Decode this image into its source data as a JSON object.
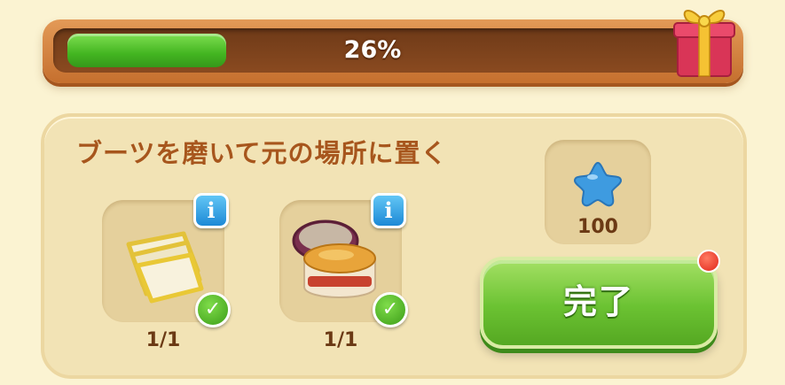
{
  "progress": {
    "percent_label": "26%",
    "fraction": 0.26
  },
  "task": {
    "title": "ブーツを磨いて元の場所に置く",
    "items": [
      {
        "icon": "polishing-cloth-icon",
        "count": "1/1",
        "completed": true
      },
      {
        "icon": "boot-polish-jar-icon",
        "count": "1/1",
        "completed": true
      }
    ]
  },
  "reward": {
    "icon": "blue-star-icon",
    "amount": "100"
  },
  "complete_button": {
    "label": "完了"
  },
  "colors": {
    "accent_green": "#6bc232",
    "bar_fill": "#43b521",
    "title_brown": "#a7561d",
    "info_blue": "#1d89d6",
    "notification_red": "#e1261a"
  }
}
